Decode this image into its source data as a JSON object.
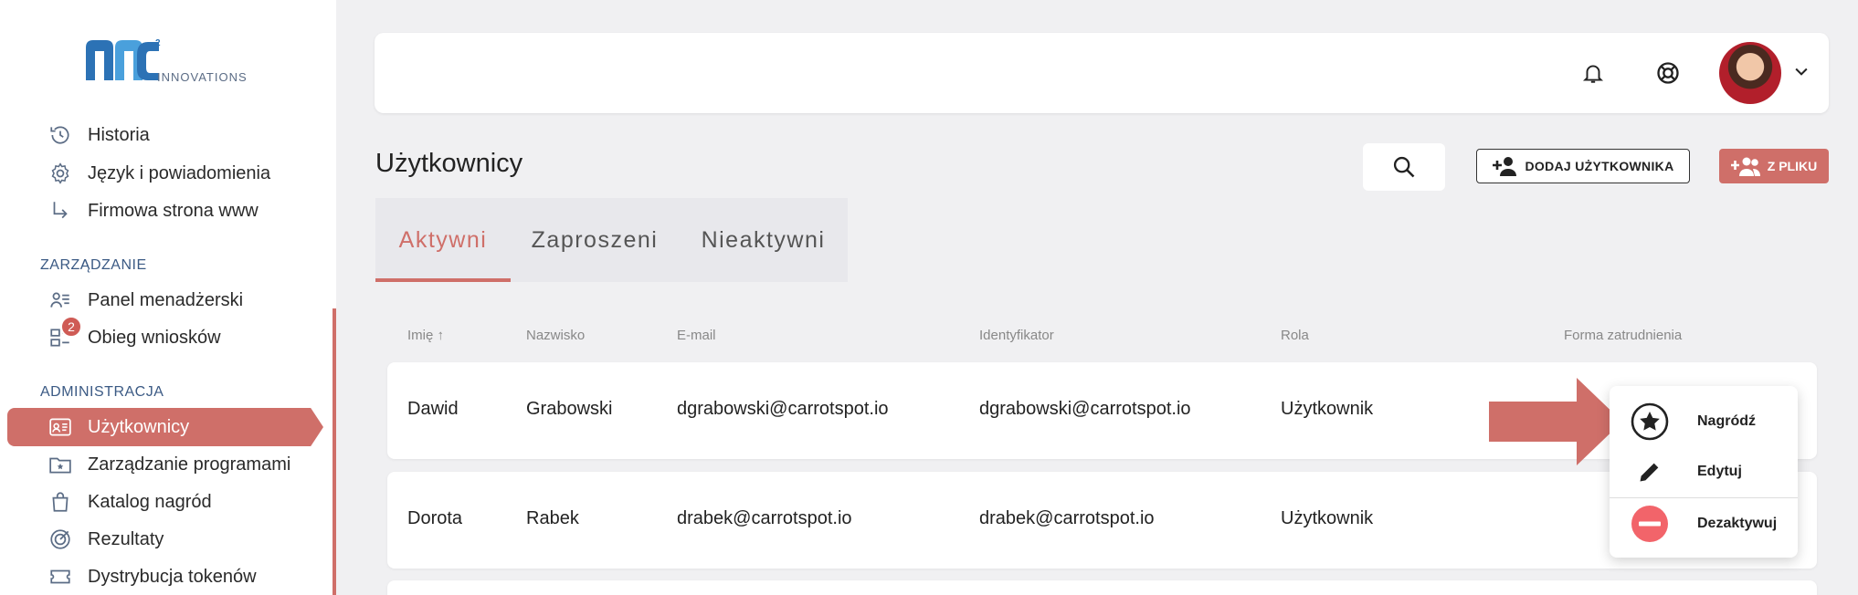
{
  "logo": {
    "text": "INNOVATIONS",
    "sup": "2"
  },
  "sidebar": {
    "items_top": [
      {
        "label": "Historia"
      },
      {
        "label": "Język i powiadomienia"
      },
      {
        "label": "Firmowa strona www"
      }
    ],
    "section_manage": "ZARZĄDZANIE",
    "items_manage": [
      {
        "label": "Panel menadżerski"
      },
      {
        "label": "Obieg wniosków",
        "badge": "2"
      }
    ],
    "section_admin": "ADMINISTRACJA",
    "items_admin": [
      {
        "label": "Użytkownicy"
      },
      {
        "label": "Zarządzanie programami"
      },
      {
        "label": "Katalog nagród"
      },
      {
        "label": "Rezultaty"
      },
      {
        "label": "Dystrybucja tokenów"
      }
    ]
  },
  "main": {
    "title": "Użytkownicy",
    "add_user_label": "DODAJ UŻYTKOWNIKA",
    "from_file_label": "Z PLIKU",
    "tabs": [
      {
        "label": "Aktywni"
      },
      {
        "label": "Zaproszeni"
      },
      {
        "label": "Nieaktywni"
      }
    ],
    "table": {
      "headers": [
        "Imię ↑",
        "Nazwisko",
        "E-mail",
        "Identyfikator",
        "Rola",
        "Forma zatrudnienia"
      ],
      "rows": [
        [
          "Dawid",
          "Grabowski",
          "dgrabowski@carrotspot.io",
          "dgrabowski@carrotspot.io",
          "Użytkownik",
          ""
        ],
        [
          "Dorota",
          "Rabek",
          "drabek@carrotspot.io",
          "drabek@carrotspot.io",
          "Użytkownik",
          ""
        ]
      ]
    }
  },
  "menu": {
    "items": [
      {
        "label": "Nagródź"
      },
      {
        "label": "Edytuj"
      },
      {
        "label": "Dezaktywuj"
      }
    ]
  },
  "colors": {
    "accent": "#cf6f69",
    "section": "#3b5a84",
    "danger": "#f2646a"
  }
}
